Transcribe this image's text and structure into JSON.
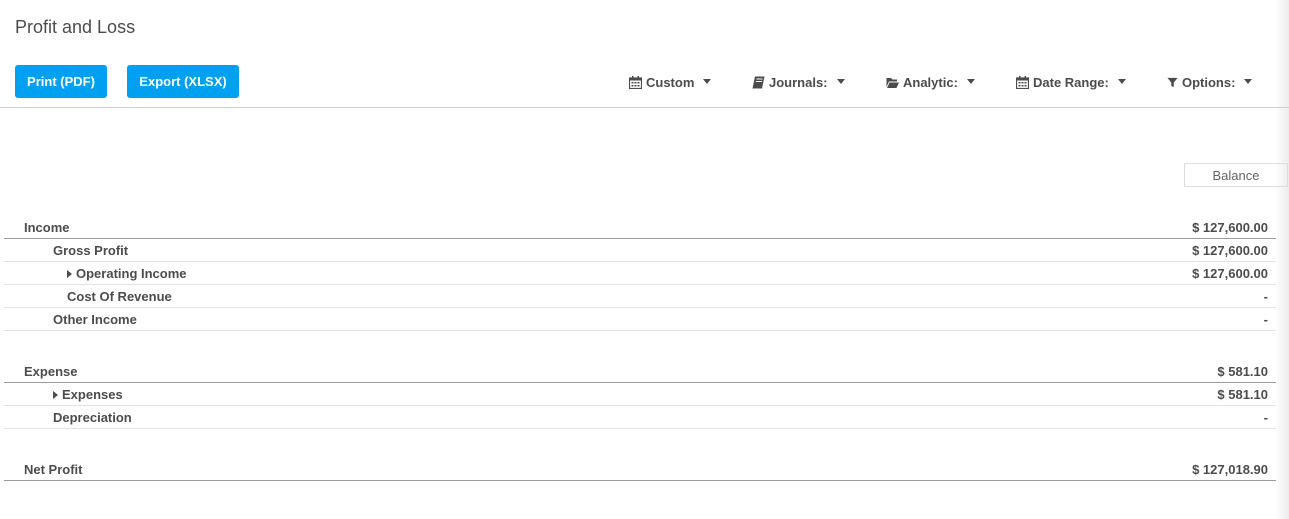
{
  "header": {
    "title": "Profit and Loss"
  },
  "toolbar": {
    "print_label": "Print (PDF)",
    "export_label": "Export (XLSX)",
    "filters": [
      {
        "label": "Custom",
        "icon": "calendar-icon"
      },
      {
        "label": "Journals:",
        "icon": "book-icon"
      },
      {
        "label": "Analytic:",
        "icon": "folder-open-icon"
      },
      {
        "label": "Date Range:",
        "icon": "calendar-icon"
      },
      {
        "label": "Options:",
        "icon": "filter-icon"
      }
    ]
  },
  "report": {
    "column_header": "Balance",
    "rows": [
      {
        "label": "Income",
        "value": "$ 127,600.00"
      },
      {
        "label": "Gross Profit",
        "value": "$ 127,600.00"
      },
      {
        "label": "Operating Income",
        "value": "$ 127,600.00"
      },
      {
        "label": "Cost Of Revenue",
        "value": "-"
      },
      {
        "label": "Other Income",
        "value": "-"
      },
      {
        "label": "Expense",
        "value": "$ 581.10"
      },
      {
        "label": "Expenses",
        "value": "$ 581.10"
      },
      {
        "label": "Depreciation",
        "value": "-"
      },
      {
        "label": "Net Profit",
        "value": "$ 127,018.90"
      }
    ]
  }
}
